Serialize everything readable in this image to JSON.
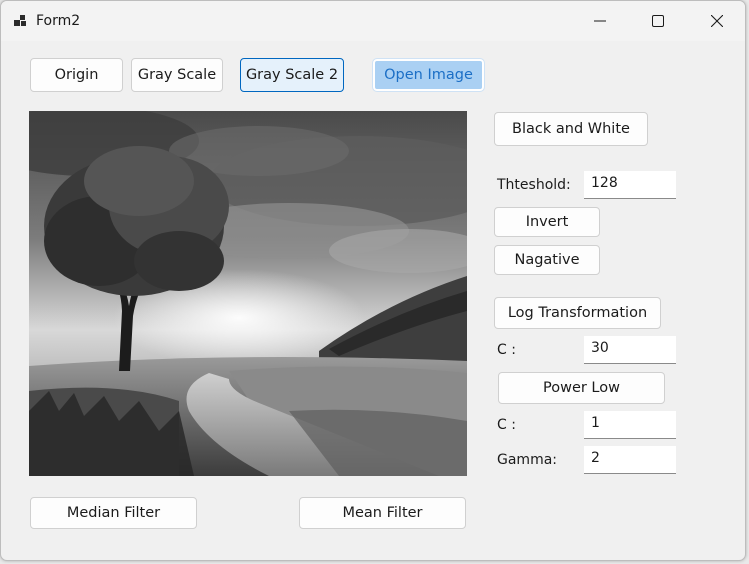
{
  "window": {
    "title": "Form2"
  },
  "buttons": {
    "origin": "Origin",
    "gray_scale": "Gray Scale",
    "gray_scale_2": "Gray Scale 2",
    "open_image": "Open Image",
    "black_and_white": "Black and White",
    "invert": "Invert",
    "negative": "Nagative",
    "log_transformation": "Log Transformation",
    "power_low": "Power Low",
    "median_filter": "Median Filter",
    "mean_filter": "Mean Filter"
  },
  "fields": {
    "threshold": {
      "label": "Thteshold:",
      "value": "128"
    },
    "log_c": {
      "label": "C :",
      "value": "30"
    },
    "power_c": {
      "label": "C :",
      "value": "1"
    },
    "gamma": {
      "label": "Gamma:",
      "value": "2"
    }
  },
  "picture": {
    "description_icon": "grayscale-landscape-image"
  },
  "colors": {
    "focus_border": "#0067c0",
    "active_fill": "#aad0f3",
    "active_text": "#1c6fc6"
  }
}
